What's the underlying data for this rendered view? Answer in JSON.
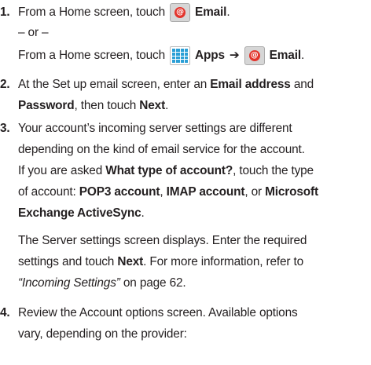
{
  "steps": [
    {
      "number": "1.",
      "line1": {
        "pre": "From a Home screen, touch",
        "email": "Email",
        "end": "."
      },
      "or": "– or –",
      "line3": {
        "pre": "From a Home screen, touch",
        "apps": "Apps",
        "arrow": "➔",
        "email": "Email",
        "end": "."
      }
    },
    {
      "number": "2.",
      "line1": {
        "pre": "At the Set up email screen, enter an",
        "bold1": "Email address",
        "post": "and"
      },
      "line2": {
        "bold1": "Password",
        "mid": ", then touch",
        "bold2": "Next",
        "end": "."
      }
    },
    {
      "number": "3.",
      "line1": "Your account’s incoming server settings are different",
      "line2": "depending on the kind of email service for the account.",
      "line3": {
        "pre": "If you are asked",
        "bold": "What type of account?",
        "post": ", touch the type"
      },
      "line4": {
        "pre": "of account:",
        "b1": "POP3 account",
        "s1": ",",
        "b2": "IMAP account",
        "s2": ", or",
        "b3": "Microsoft"
      },
      "line5": {
        "bold": "Exchange ActiveSync",
        "end": "."
      },
      "line6": "The Server settings screen displays. Enter the required",
      "line7": {
        "pre": "settings and touch",
        "bold": "Next",
        "post": ". For more information, refer to"
      },
      "line8": {
        "italic": "“Incoming Settings”",
        "post": " on page 62."
      }
    },
    {
      "number": "4.",
      "line1": "Review the Account options screen. Available options",
      "line2": "vary, depending on the provider:"
    }
  ],
  "icons": {
    "email": "email-app-icon",
    "apps": "apps-grid-icon"
  },
  "colors": {
    "text": "#231f20",
    "email_red": "#e3342c",
    "apps_blue": "#2b9fd6"
  }
}
